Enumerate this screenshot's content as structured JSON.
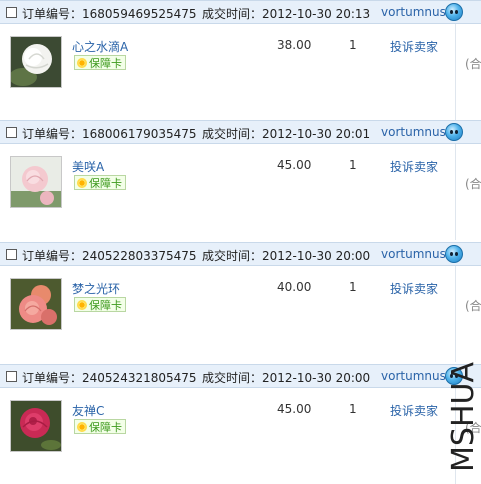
{
  "order_no_label": "订单编号：",
  "deal_time_label": "成交时间：",
  "badge_label": "保障卡",
  "complain_label": "投诉卖家",
  "hetong_label": "(合",
  "watermark": "MSHUA",
  "orders": [
    {
      "order_no": "168059469525475",
      "deal_time": "2012-10-30 20:13",
      "seller": "vortumnus",
      "product_name": "心之水滴A",
      "price": "38.00",
      "qty": "1",
      "image": "white-rose-thumbnail"
    },
    {
      "order_no": "168006179035475",
      "deal_time": "2012-10-30 20:01",
      "seller": "vortumnus",
      "product_name": "美咲A",
      "price": "45.00",
      "qty": "1",
      "image": "pale-pink-rose-thumbnail"
    },
    {
      "order_no": "240522803375475",
      "deal_time": "2012-10-30 20:00",
      "seller": "vortumnus",
      "product_name": "梦之光环",
      "price": "40.00",
      "qty": "1",
      "image": "coral-pink-rose-thumbnail"
    },
    {
      "order_no": "240524321805475",
      "deal_time": "2012-10-30 20:00",
      "seller": "vortumnus",
      "product_name": "友禅C",
      "price": "45.00",
      "qty": "1",
      "image": "deep-pink-rose-thumbnail"
    }
  ],
  "colors": {
    "header_bg": "#e7f0fa",
    "link_blue": "#2a63a8",
    "badge_green": "#3d9a1d"
  }
}
